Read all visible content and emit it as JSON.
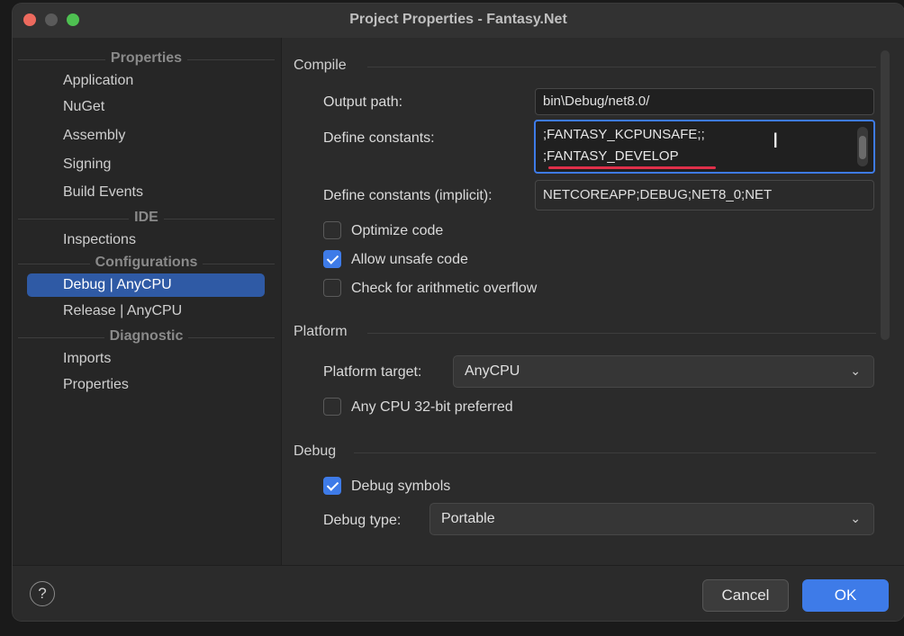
{
  "window": {
    "title": "Project Properties - Fantasy.Net"
  },
  "sidebar": {
    "groups": {
      "properties": "Properties",
      "ide": "IDE",
      "configurations": "Configurations",
      "diagnostic": "Diagnostic"
    },
    "items": {
      "application": "Application",
      "nuget": "NuGet",
      "assembly": "Assembly",
      "signing": "Signing",
      "build_events": "Build Events",
      "inspections": "Inspections",
      "debug_anycpu": "Debug | AnyCPU",
      "release_anycpu": "Release | AnyCPU",
      "imports": "Imports",
      "properties": "Properties"
    },
    "selected": "Debug | AnyCPU"
  },
  "compile": {
    "section": "Compile",
    "output_path_label": "Output path:",
    "output_path_value": "bin\\Debug/net8.0/",
    "define_constants_label": "Define constants:",
    "define_constants_lines": [
      ";FANTASY_KCPUNSAFE;;",
      ";FANTASY_DEVELOP"
    ],
    "define_implicit_label": "Define constants (implicit):",
    "define_implicit_value": "NETCOREAPP;DEBUG;NET8_0;NET",
    "optimize_label": "Optimize code",
    "optimize_checked": false,
    "unsafe_label": "Allow unsafe code",
    "unsafe_checked": true,
    "overflow_label": "Check for arithmetic overflow",
    "overflow_checked": false
  },
  "platform": {
    "section": "Platform",
    "target_label": "Platform target:",
    "target_value": "AnyCPU",
    "prefer32_label": "Any CPU 32-bit preferred",
    "prefer32_checked": false
  },
  "debug": {
    "section": "Debug",
    "symbols_label": "Debug symbols",
    "symbols_checked": true,
    "type_label": "Debug type:",
    "type_value": "Portable"
  },
  "footer": {
    "help": "?",
    "cancel": "Cancel",
    "ok": "OK"
  },
  "colors": {
    "accent": "#3e7be8",
    "selection": "#2f5aa5",
    "underline": "#e0304a"
  }
}
